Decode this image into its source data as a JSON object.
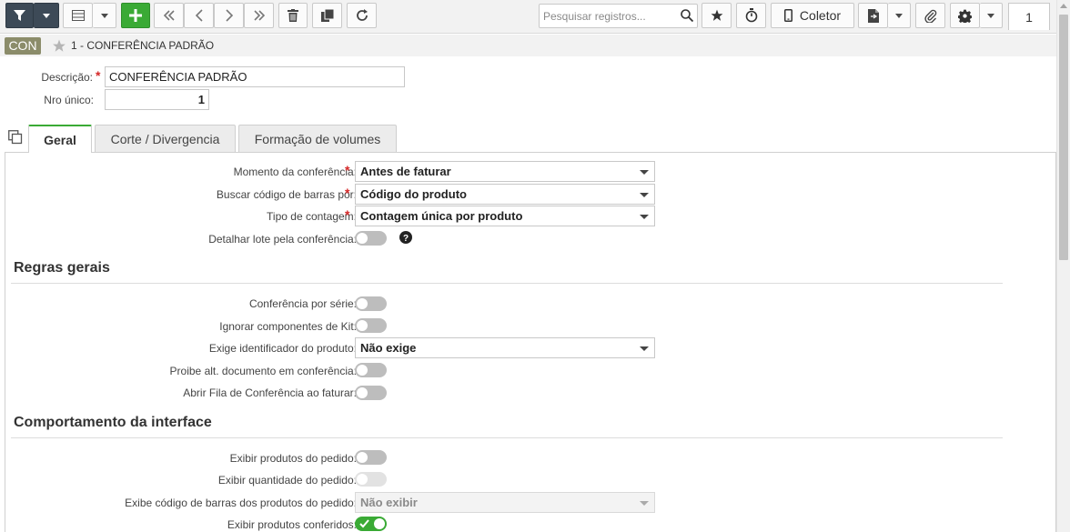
{
  "toolbar": {
    "search_placeholder": "Pesquisar registros...",
    "coletor_label": "Coletor",
    "page_number": "1",
    "icons": [
      "filter-icon",
      "grid-icon",
      "plus-icon",
      "first-record-icon",
      "previous-record-icon",
      "next-record-icon",
      "last-record-icon",
      "trash-icon",
      "copy-record-icon",
      "refresh-icon",
      "search-icon",
      "star-icon",
      "timer-icon",
      "phone-icon",
      "document-icon",
      "paperclip-icon",
      "gear-icon"
    ]
  },
  "header": {
    "badge": "CON",
    "record_title": "1 - CONFERÊNCIA PADRÃO",
    "descricao_label": "Descrição:",
    "descricao_value": "CONFERÊNCIA PADRÃO",
    "nro_unico_label": "Nro único:",
    "nro_unico_value": "1"
  },
  "tabs": [
    {
      "label": "Geral",
      "active": true
    },
    {
      "label": "Corte / Divergencia",
      "active": false
    },
    {
      "label": "Formação de volumes",
      "active": false
    }
  ],
  "form": {
    "momento": {
      "label": "Momento da conferência:",
      "value": "Antes de faturar",
      "required": true
    },
    "buscar": {
      "label": "Buscar código de barras por:",
      "value": "Código do produto",
      "required": true
    },
    "tipo": {
      "label": "Tipo de contagem:",
      "value": "Contagem única por produto",
      "required": true
    },
    "detalhar": {
      "label": "Detalhar lote pela conferência:",
      "on": false
    },
    "regras_title": "Regras gerais",
    "conf_serie": {
      "label": "Conferência por série:",
      "on": false
    },
    "ignorar_kit": {
      "label": "Ignorar componentes de Kit:",
      "on": false
    },
    "exige_id": {
      "label": "Exige identificador do produto:",
      "value": "Não exige"
    },
    "proibe_alt": {
      "label": "Proibe alt. documento em conferência:",
      "on": false
    },
    "abrir_fila": {
      "label": "Abrir Fila de Conferência ao faturar:",
      "on": false
    },
    "comportamento_title": "Comportamento da interface",
    "exibir_prod_pedido": {
      "label": "Exibir produtos do pedido:",
      "on": false
    },
    "exibir_qtd_pedido": {
      "label": "Exibir quantidade do pedido:",
      "on": false,
      "disabled": true
    },
    "exibe_cod_barras": {
      "label": "Exibe código de barras dos produtos do pedido:",
      "value": "Não exibir",
      "disabled": true
    },
    "exibir_conferidos": {
      "label": "Exibir produtos conferidos:",
      "on": true
    }
  },
  "colors": {
    "accent_green": "#3aaa35",
    "dark_button": "#3d4a57",
    "required_red": "#d62828",
    "badge_bg": "#8b8c6a"
  }
}
